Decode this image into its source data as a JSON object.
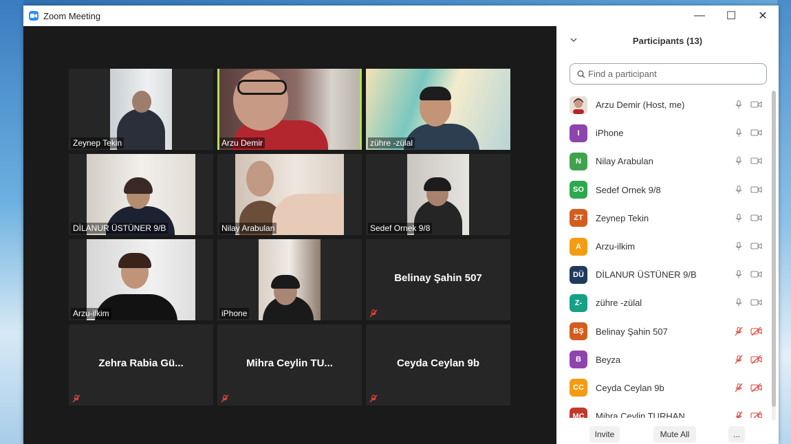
{
  "window": {
    "title": "Zoom Meeting",
    "controls": {
      "minimize": "—",
      "maximize": "☐",
      "close": "✕"
    }
  },
  "gallery": [
    {
      "name": "Zeynep Tekin",
      "video": true,
      "active": false
    },
    {
      "name": "Arzu Demir",
      "video": true,
      "active": true
    },
    {
      "name": "zühre -zülal",
      "video": true,
      "active": false
    },
    {
      "name": "DİLANUR ÜSTÜNER 9/B",
      "video": true,
      "active": false
    },
    {
      "name": "Nilay Arabulan",
      "video": true,
      "active": false
    },
    {
      "name": "Sedef Ornek 9/8",
      "video": true,
      "active": false
    },
    {
      "name": "Arzu-ilkim",
      "video": true,
      "active": false
    },
    {
      "name": "iPhone",
      "video": true,
      "active": false
    },
    {
      "name": "Belinay Şahin 507",
      "video": false,
      "muted": true
    },
    {
      "name": "Zehra Rabia Gü...",
      "video": false,
      "muted": true
    },
    {
      "name": "Mihra Ceylin TU...",
      "video": false,
      "muted": true
    },
    {
      "name": "Ceyda Ceylan 9b",
      "video": false,
      "muted": true
    }
  ],
  "participants_panel": {
    "title": "Participants (13)",
    "search_placeholder": "Find a participant",
    "participants": [
      {
        "initials": "",
        "name": "Arzu Demir (Host, me)",
        "color": "#e8d7cc",
        "mic": "on",
        "camera": "on"
      },
      {
        "initials": "I",
        "name": "iPhone",
        "color": "#8e44ad",
        "mic": "on",
        "camera": "on"
      },
      {
        "initials": "N",
        "name": "Nilay Arabulan",
        "color": "#3fa34d",
        "mic": "on",
        "camera": "on"
      },
      {
        "initials": "SO",
        "name": "Sedef Ornek 9/8",
        "color": "#2ea84f",
        "mic": "on",
        "camera": "on"
      },
      {
        "initials": "ZT",
        "name": "Zeynep Tekin",
        "color": "#d35d1e",
        "mic": "on",
        "camera": "on"
      },
      {
        "initials": "A",
        "name": "Arzu-ilkim",
        "color": "#f39c12",
        "mic": "on",
        "camera": "on"
      },
      {
        "initials": "DÜ",
        "name": "DİLANUR ÜSTÜNER 9/B",
        "color": "#1f3a5f",
        "mic": "on",
        "camera": "on"
      },
      {
        "initials": "Z-",
        "name": "zühre -zülal",
        "color": "#16a085",
        "mic": "on",
        "camera": "on"
      },
      {
        "initials": "BŞ",
        "name": "Belinay Şahin 507",
        "color": "#d35d1e",
        "mic": "muted",
        "camera": "off"
      },
      {
        "initials": "B",
        "name": "Beyza",
        "color": "#8e44ad",
        "mic": "muted",
        "camera": "off"
      },
      {
        "initials": "CC",
        "name": "Ceyda Ceylan 9b",
        "color": "#f39c12",
        "mic": "muted",
        "camera": "off"
      },
      {
        "initials": "MC",
        "name": "Mihra Ceylin TURHAN",
        "color": "#c0392b",
        "mic": "muted",
        "camera": "off"
      }
    ],
    "footer": {
      "invite": "Invite",
      "mute_all": "Mute All",
      "more": "..."
    }
  },
  "colors": {
    "active_speaker": "#b5e05a",
    "muted_red": "#e0453a",
    "zoom_blue": "#2d8cff"
  }
}
